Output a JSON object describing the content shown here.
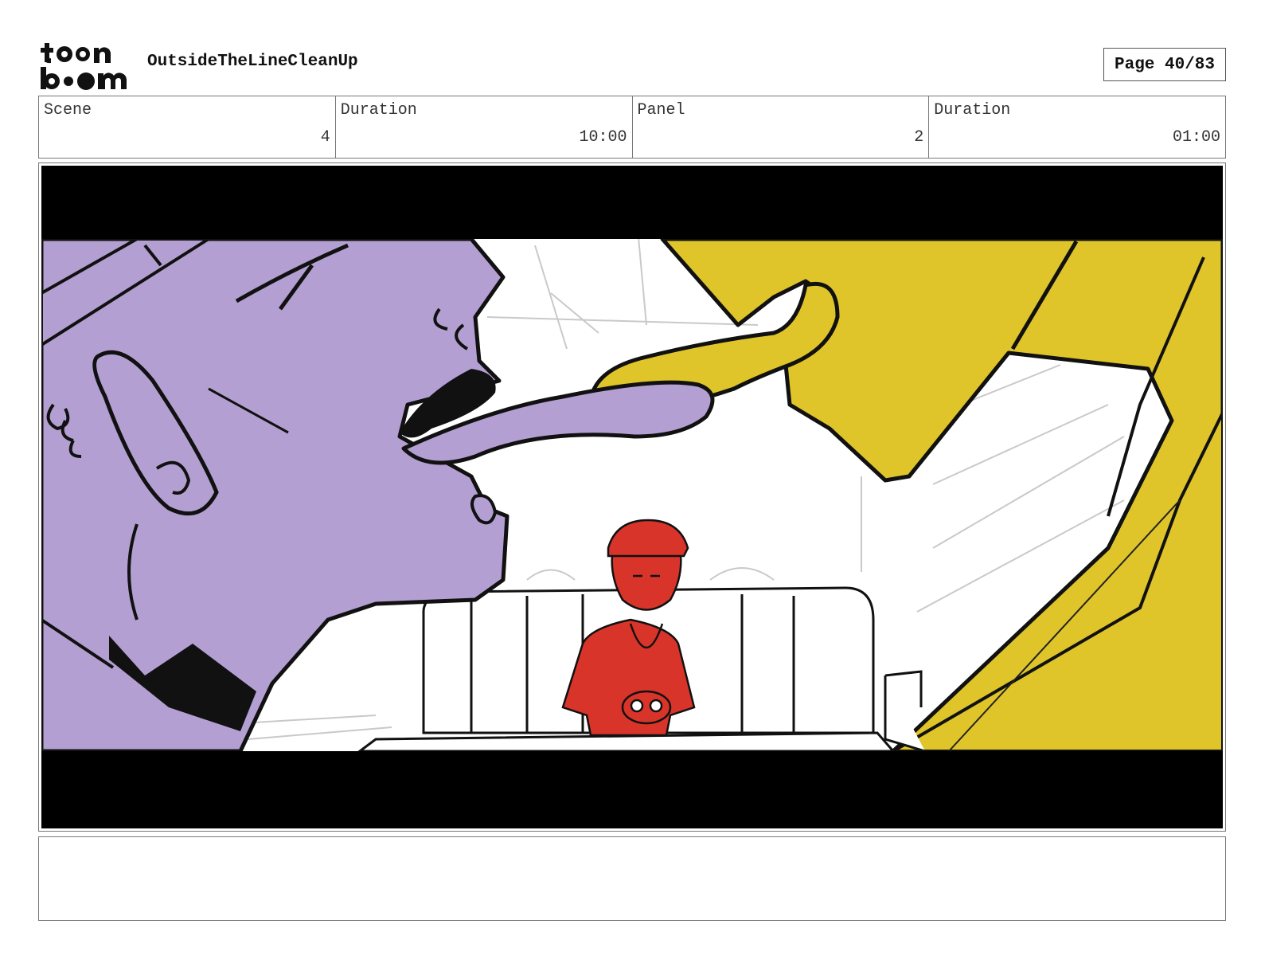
{
  "header": {
    "logo_text": "toonboom",
    "project_title": "OutsideTheLineCleanUp",
    "page_label": "Page 40/83"
  },
  "info": {
    "scene_label": "Scene",
    "scene_value": "4",
    "scene_duration_label": "Duration",
    "scene_duration_value": "10:00",
    "panel_label": "Panel",
    "panel_value": "2",
    "panel_duration_label": "Duration",
    "panel_duration_value": "01:00"
  },
  "colors": {
    "purple_character": "#b39fd1",
    "yellow_character": "#dfc52a",
    "red_character": "#d8342a",
    "letterbox": "#000000"
  },
  "notes": {
    "text": ""
  }
}
